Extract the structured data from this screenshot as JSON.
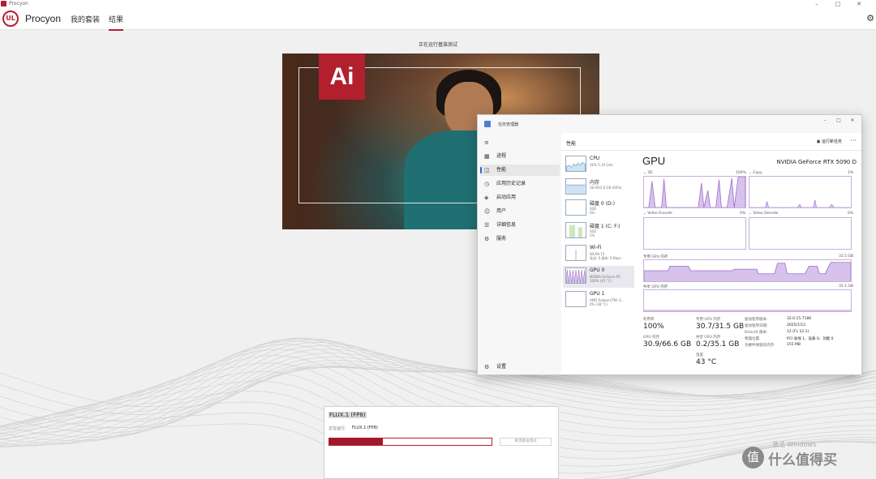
{
  "window": {
    "title": "Procyon"
  },
  "header": {
    "brand": "Procyon",
    "logo_text": "UL",
    "tabs": [
      {
        "label": "我的套装",
        "active": false
      },
      {
        "label": "结果",
        "active": true
      }
    ]
  },
  "main": {
    "running_text": "正在运行基准测试",
    "art_logo_text": "Ai"
  },
  "taskmanager": {
    "title": "任务管理器",
    "header_title": "性能",
    "new_task": "运行新任务",
    "sidebar": [
      {
        "label": "进程",
        "icon": "grid-icon"
      },
      {
        "label": "性能",
        "icon": "chart-icon",
        "active": true
      },
      {
        "label": "应用历史记录",
        "icon": "history-icon"
      },
      {
        "label": "启动应用",
        "icon": "startup-icon"
      },
      {
        "label": "用户",
        "icon": "users-icon"
      },
      {
        "label": "详细信息",
        "icon": "list-icon"
      },
      {
        "label": "服务",
        "icon": "services-icon"
      }
    ],
    "settings_label": "设置",
    "devices": [
      {
        "name": "CPU",
        "sub1": "36% 5.19 GHz",
        "sub2": ""
      },
      {
        "name": "内存",
        "sub1": "38.9/63.6 GB (60%)",
        "sub2": ""
      },
      {
        "name": "磁盘 0 (D:)",
        "sub1": "SSD",
        "sub2": "0%"
      },
      {
        "name": "磁盘 1 (C: F:)",
        "sub1": "SSD",
        "sub2": "1%"
      },
      {
        "name": "Wi-Fi",
        "sub1": "WLAN 15",
        "sub2": "发送: 0 接收: 0 Kbps"
      },
      {
        "name": "GPU 0",
        "sub1": "NVIDIA GeForce RT...",
        "sub2": "100% (43 °C)"
      },
      {
        "name": "GPU 1",
        "sub1": "AMD Radeon(TM) G...",
        "sub2": "0% (38 °C)"
      }
    ],
    "gpu": {
      "heading": "GPU",
      "model": "NVIDIA GeForce RTX 5090 D",
      "graph_3d": {
        "label": "3D",
        "max": "100%",
        "min": "0%"
      },
      "graph_copy": {
        "label": "Copy",
        "max": "1%",
        "min": "0%"
      },
      "graph_encode": {
        "label": "Video Encode",
        "min": "0%"
      },
      "graph_decode": {
        "label": "Video Decode",
        "min": "0%"
      },
      "dedicated_label": "专用 GPU 内存",
      "dedicated_max": "31.5 GB",
      "shared_label": "共享 GPU 内存",
      "shared_max": "35.1 GB",
      "stats": {
        "util_label": "利用率",
        "util_value": "100%",
        "ded_label": "专用 GPU 内存",
        "ded_value": "30.7/31.5 GB",
        "gpu_mem_label": "GPU 内存",
        "gpu_mem_value": "30.9/66.6 GB",
        "shared_label": "共享 GPU 内存",
        "shared_value": "0.2/35.1 GB",
        "temp_label": "温度",
        "temp_value": "43 °C"
      },
      "info": [
        {
          "k": "驱动程序版本:",
          "v": "32.0.15.7186"
        },
        {
          "k": "驱动程序日期:",
          "v": "2025/1/12"
        },
        {
          "k": "DirectX 版本:",
          "v": "12 (FL 12.1)"
        },
        {
          "k": "物理位置:",
          "v": "PCI 总线 1、设备 0、功能 0"
        },
        {
          "k": "为硬件保留的内存:",
          "v": "155 MB"
        }
      ]
    }
  },
  "progress": {
    "title": "FLUX.1 (FP8)",
    "running_label": "正在运行:",
    "running_value": "FLUX.1 (FP8)",
    "fraction": 0.33,
    "cancel_label": "取消基准测试"
  },
  "watermark": {
    "activate_text": "激活 Windows",
    "site_icon_glyph": "值",
    "site_text": "什么值得买"
  },
  "colors": {
    "accent": "#b21f2d",
    "gpu_graph": "#b89cd9"
  }
}
